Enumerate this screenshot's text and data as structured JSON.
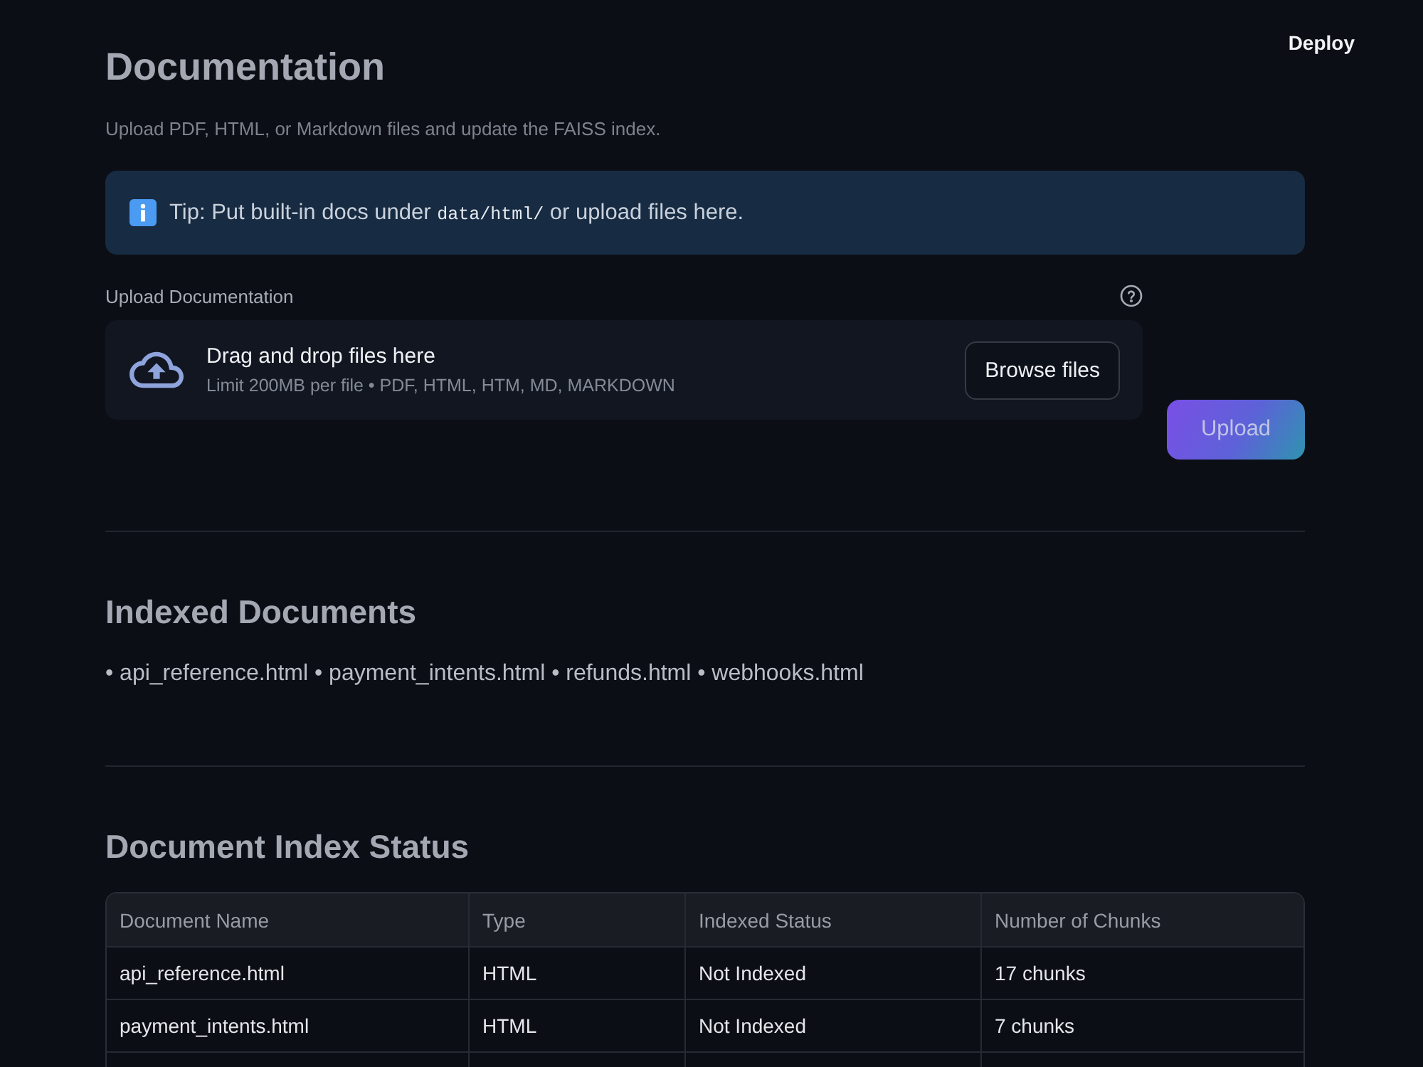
{
  "header": {
    "deploy_label": "Deploy"
  },
  "page": {
    "title": "Documentation",
    "subtitle": "Upload PDF, HTML, or Markdown files and update the FAISS index."
  },
  "tip": {
    "parts": [
      {
        "kind": "text",
        "text": "Tip: Put built-in docs under "
      },
      {
        "kind": "code",
        "text": "data/html/"
      },
      {
        "kind": "text",
        "text": " or upload files here."
      }
    ]
  },
  "uploader": {
    "label": "Upload Documentation",
    "dropzone_title": "Drag and drop files here",
    "dropzone_hint": "Limit 200MB per file • PDF, HTML, HTM, MD, MARKDOWN",
    "browse_button": "Browse files"
  },
  "upload_button": {
    "label": "Upload"
  },
  "indexed_documents": {
    "heading": "Indexed Documents",
    "text": "• api_reference.html • payment_intents.html • refunds.html • webhooks.html"
  },
  "index_status": {
    "heading": "Document Index Status",
    "table": {
      "columns": [
        "Document Name",
        "Type",
        "Indexed Status",
        "Number of Chunks"
      ],
      "rows": [
        [
          "api_reference.html",
          "HTML",
          "Not Indexed",
          "17 chunks"
        ],
        [
          "payment_intents.html",
          "HTML",
          "Not Indexed",
          "7 chunks"
        ]
      ]
    }
  }
}
